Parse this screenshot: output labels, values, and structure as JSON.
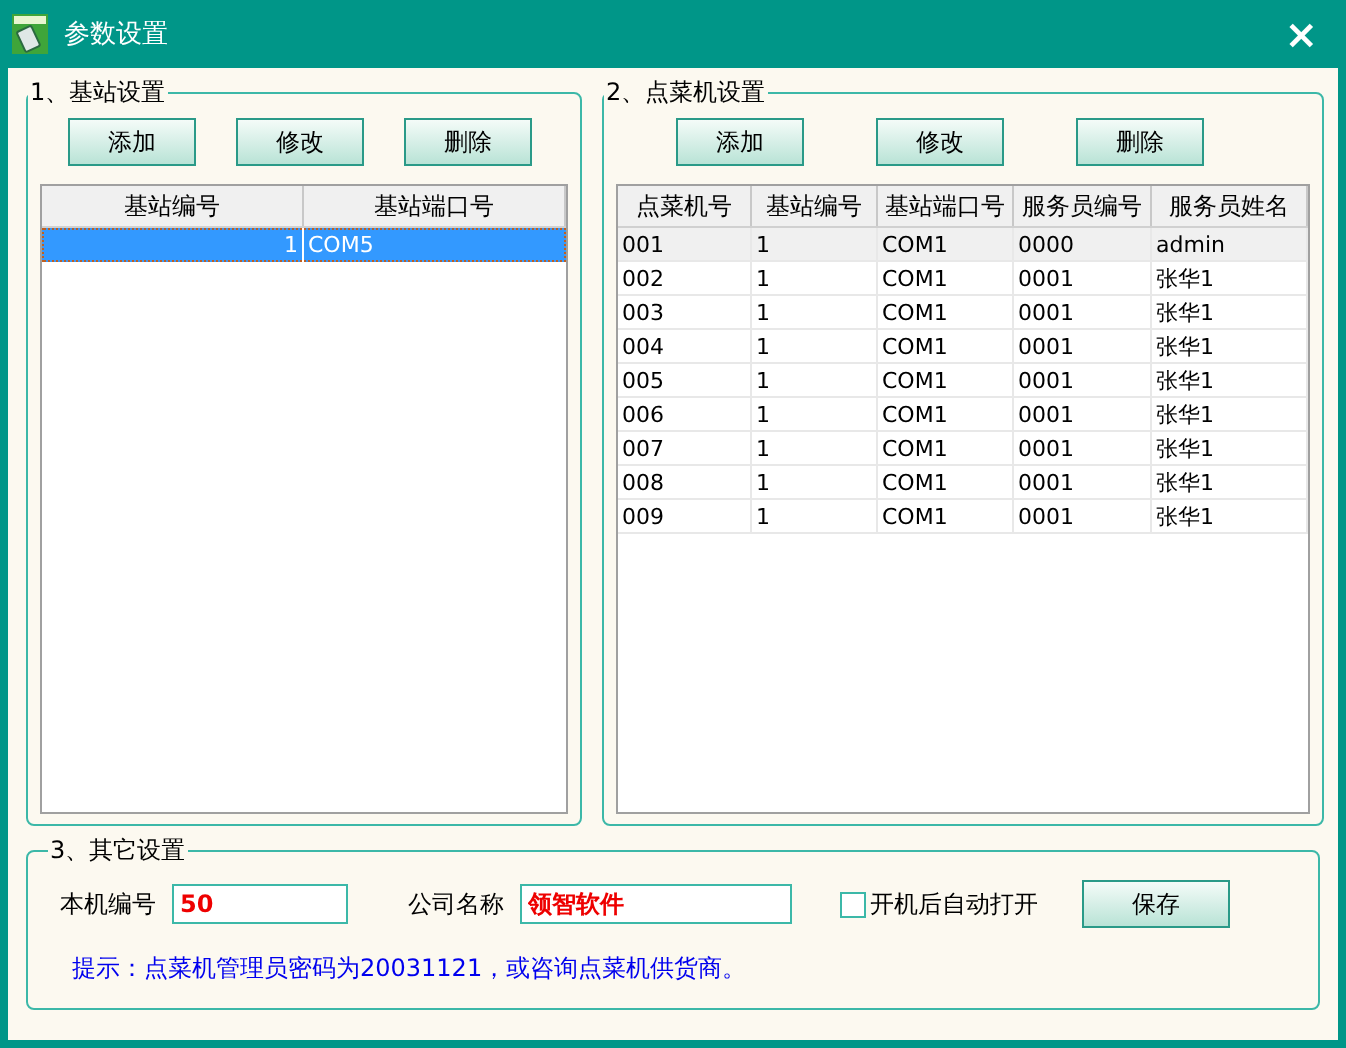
{
  "window": {
    "title": "参数设置",
    "close": "×"
  },
  "station_group": {
    "legend": "1、基站设置",
    "buttons": [
      "添加",
      "修改",
      "删除"
    ],
    "table": {
      "focused": true,
      "columns": [
        "基站编号",
        "基站端口号"
      ],
      "rows": [
        {
          "cells": [
            "1",
            "COM5"
          ],
          "selected": true
        }
      ]
    }
  },
  "terminal_group": {
    "legend": "2、点菜机设置",
    "buttons": [
      "添加",
      "修改",
      "删除"
    ],
    "table": {
      "focused": false,
      "columns": [
        "点菜机号",
        "基站编号",
        "基站端口号",
        "服务员编号",
        "服务员姓名"
      ],
      "rows": [
        {
          "cells": [
            "001",
            "1",
            "COM1",
            "0000",
            "admin"
          ],
          "selected": true
        },
        {
          "cells": [
            "002",
            "1",
            "COM1",
            "0001",
            "张华1"
          ],
          "selected": false
        },
        {
          "cells": [
            "003",
            "1",
            "COM1",
            "0001",
            "张华1"
          ],
          "selected": false
        },
        {
          "cells": [
            "004",
            "1",
            "COM1",
            "0001",
            "张华1"
          ],
          "selected": false
        },
        {
          "cells": [
            "005",
            "1",
            "COM1",
            "0001",
            "张华1"
          ],
          "selected": false
        },
        {
          "cells": [
            "006",
            "1",
            "COM1",
            "0001",
            "张华1"
          ],
          "selected": false
        },
        {
          "cells": [
            "007",
            "1",
            "COM1",
            "0001",
            "张华1"
          ],
          "selected": false
        },
        {
          "cells": [
            "008",
            "1",
            "COM1",
            "0001",
            "张华1"
          ],
          "selected": false
        },
        {
          "cells": [
            "009",
            "1",
            "COM1",
            "0001",
            "张华1"
          ],
          "selected": false
        }
      ]
    }
  },
  "other_group": {
    "legend": "3、其它设置",
    "machine_label": "本机编号",
    "machine_value": "50",
    "company_label": "公司名称",
    "company_value": "领智软件",
    "autostart": {
      "label": "开机后自动打开",
      "checked": false
    },
    "save_button": "保存",
    "hint": "提示：点菜机管理员密码为20031121，或咨询点菜机供货商。"
  }
}
